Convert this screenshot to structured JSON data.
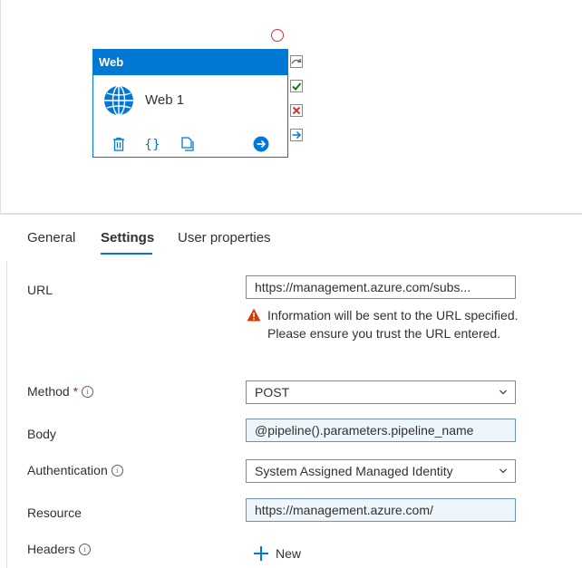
{
  "canvas": {
    "node": {
      "header": "Web",
      "name": "Web 1",
      "icon": "globe-icon"
    },
    "actions": [
      "delete-icon",
      "code-braces-icon",
      "copy-icon",
      "arrow-right-circle-icon"
    ],
    "ports": [
      "skip-port-icon",
      "success-check-icon",
      "failure-x-icon",
      "completion-arrow-icon"
    ]
  },
  "tabs": [
    {
      "label": "General",
      "active": false
    },
    {
      "label": "Settings",
      "active": true
    },
    {
      "label": "User properties",
      "active": false
    }
  ],
  "form": {
    "url": {
      "label": "URL",
      "value": "https://management.azure.com/subs..."
    },
    "warning": "Information will be sent to the URL specified. Please ensure you trust the URL entered.",
    "method": {
      "label": "Method",
      "required_mark": "*",
      "value": "POST"
    },
    "body": {
      "label": "Body",
      "value": "@pipeline().parameters.pipeline_name"
    },
    "authentication": {
      "label": "Authentication",
      "value": "System Assigned Managed Identity"
    },
    "resource": {
      "label": "Resource",
      "value": "https://management.azure.com/"
    },
    "headers": {
      "label": "Headers",
      "new_label": "New"
    }
  },
  "colors": {
    "accent": "#0078d4",
    "warning": "#d83b01",
    "error": "#d13438",
    "success": "#107c10"
  }
}
